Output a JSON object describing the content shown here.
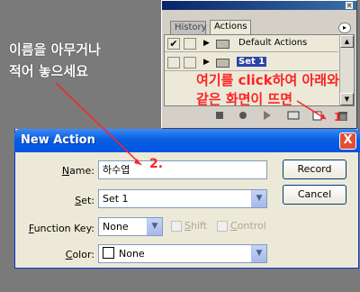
{
  "annotations": {
    "white_note_line1": "이름을 아무거나",
    "white_note_line2": "적어 놓으세요",
    "red_note_line1": "여기를 click하여 아래와",
    "red_note_line2": "같은 화면이 뜨면",
    "step1": "1",
    "step2": "2.",
    "red_color": "#ff2222"
  },
  "actions_panel": {
    "tabs": [
      {
        "label": "History",
        "active": false
      },
      {
        "label": "Actions",
        "active": true
      }
    ],
    "rows": [
      {
        "label": "Default Actions",
        "checked": true,
        "selected": false
      },
      {
        "label": "Set 1",
        "checked": false,
        "selected": true
      }
    ],
    "tool_icons": [
      "stop-icon",
      "record-icon",
      "play-icon",
      "new-set-icon",
      "new-action-icon",
      "delete-icon"
    ]
  },
  "dialog": {
    "title": "New Action",
    "close_label": "X",
    "name_label_u": "N",
    "name_label_rest": "ame:",
    "name_value": "하수엽",
    "set_label_u": "S",
    "set_label_rest": "et:",
    "set_value": "Set 1",
    "function_key_label_u": "F",
    "function_key_label_rest": "unction Key:",
    "function_key_value": "None",
    "shift_label_u": "S",
    "shift_label_rest": "hift",
    "control_label_u": "C",
    "control_label_rest": "ontrol",
    "color_label_u": "C",
    "color_label_rest": "olor:",
    "color_value": "None",
    "record_label": "Record",
    "cancel_label": "Cancel"
  }
}
